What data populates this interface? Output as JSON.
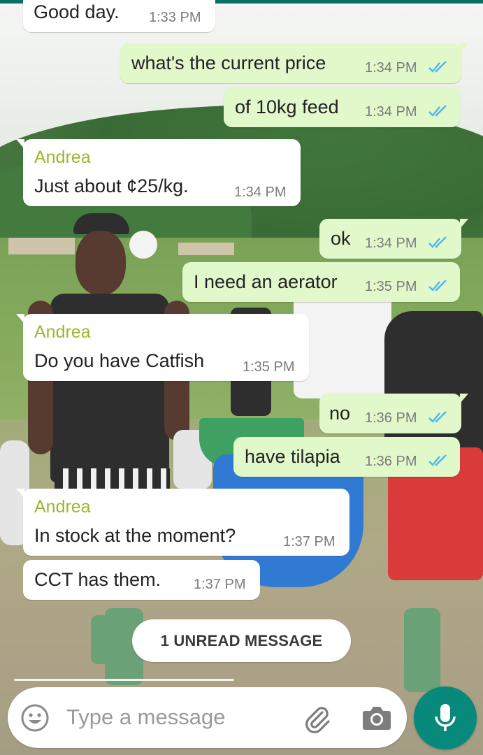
{
  "messages": [
    {
      "direction": "in",
      "sender": "",
      "text": "Good day.",
      "time": "1:33 PM"
    },
    {
      "direction": "out",
      "text": "what's the current price",
      "time": "1:34 PM"
    },
    {
      "direction": "out",
      "text": "of 10kg feed",
      "time": "1:34 PM"
    },
    {
      "direction": "in",
      "sender": "Andrea",
      "text": "Just about ¢25/kg.",
      "time": "1:34 PM"
    },
    {
      "direction": "out",
      "text": "ok",
      "time": "1:34 PM"
    },
    {
      "direction": "out",
      "text": "I need an aerator",
      "time": "1:35 PM"
    },
    {
      "direction": "in",
      "sender": "Andrea",
      "text": "Do you have Catfish",
      "time": "1:35 PM"
    },
    {
      "direction": "out",
      "text": "no",
      "time": "1:36 PM"
    },
    {
      "direction": "out",
      "text": "have tilapia",
      "time": "1:36 PM"
    },
    {
      "direction": "in",
      "sender": "Andrea",
      "text": "In stock at the moment?",
      "time": "1:37 PM"
    },
    {
      "direction": "in",
      "sender": "",
      "text": "CCT has them.",
      "time": "1:37 PM"
    }
  ],
  "unread_banner": "1 UNREAD MESSAGE",
  "composer": {
    "placeholder": "Type a message",
    "icons": [
      "emoji-icon",
      "attach-icon",
      "camera-icon",
      "microphone-icon"
    ]
  },
  "colors": {
    "outgoing_bubble": "#e1f8cb",
    "incoming_bubble": "#ffffff",
    "sender_name": "#9cb630",
    "read_ticks": "#4fb6ec",
    "mic_button": "#07897b",
    "header_line": "#0b6e5f"
  }
}
